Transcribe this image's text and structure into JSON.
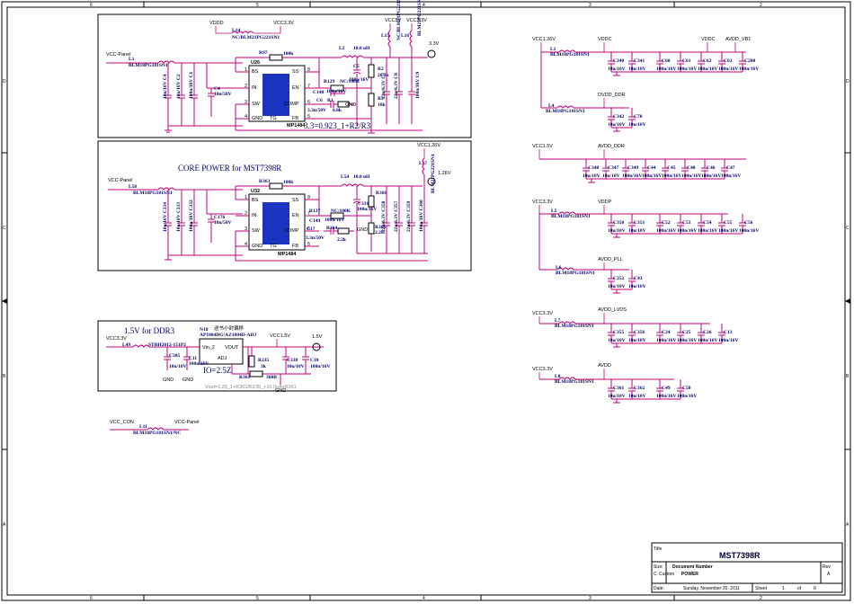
{
  "frame": {
    "cols": [
      "6",
      "5",
      "4",
      "3",
      "2",
      "1"
    ],
    "rows": [
      "D",
      "C",
      "B",
      "A"
    ]
  },
  "sections": {
    "core_power_title": "CORE POWER for MST7398R",
    "ddr_title": "1.5V  for  DDR3",
    "formula": "3.3=0.923_1+R2/R3",
    "vout_formula": "Vout=1.25_1+R361/R235_+10.0uAxR361"
  },
  "nets": {
    "vddd": "VDDD",
    "vcc33": "VCC3.3V",
    "vcc5v": "VCC5V",
    "vcc_panel": "VCC-Panel",
    "vcc126": "VCC1.26V",
    "vcc15": "VCC1.5V",
    "v15": "1.5V",
    "v126": "1.26V",
    "v33": "3.3V",
    "vddc": "VDDC",
    "avdd_vb1": "AVDD_VB1",
    "dvdd_ddr": "DVDD_DDR",
    "avdd_ddr": "AVDD_DDR",
    "vddp": "VDDP",
    "avdd_pll": "AVDD_PLL",
    "avdd_lvds": "AVDD_LVDS",
    "avdd": "AVDD",
    "vcc_con": "VCC_CON",
    "gnd": "GND"
  },
  "parts": {
    "l14": "L14",
    "l14_val": "NC/BLM21PG221SN1",
    "l1": "L1",
    "l1_val": "BLM18PG181SN1",
    "u26": "U26",
    "u26_part": "MP1484",
    "l2": "L2",
    "l2_val": "10.0 uH",
    "r97": "R97",
    "r97_val": "100k",
    "c5": "C5",
    "c5_val": "100u/16V",
    "r2": "R2",
    "r2_val": "26.1k",
    "r3": "R3",
    "r3_val": "10k",
    "r129": "R129",
    "r129_val": "NC/100K",
    "c148": "C148",
    "c148_val": "100n/16V",
    "c6": "C6",
    "r1": "R1",
    "r1_val": "6.8k",
    "c6_val": "3.3n/50V",
    "c4": "C4",
    "c4_val": "10n/50V",
    "l15": "L15",
    "l16": "L16",
    "u32": "U32",
    "u32_part": "MP1484",
    "l58": "L58",
    "l58_val": "BLM18PG181SN1",
    "l54": "L54",
    "l54_val": "10.0 uH",
    "r363": "R363",
    "r363_val": "100k",
    "c176": "C176",
    "c176_val": "10n/50V",
    "r137": "R137",
    "r137_val": "NC/100K",
    "c149": "C149",
    "c149_val": "100n/16V",
    "c17": "C17",
    "c17_val": "3.3n/50V",
    "r364": "R364",
    "r364_val": "2.2k",
    "r366": "R366",
    "c331": "C331",
    "c331_val": "100u/16V",
    "r365": "R365",
    "r365_val": "2.2K",
    "l17": "L17",
    "n18": "N18",
    "n18_part": "AP1084DG/AZ1084D-ADJ",
    "n18_note": "送书小封偏移",
    "l49": "L49",
    "l49_val": "STBH2012-151P2",
    "c385": "C385",
    "c385_val": "10u/10V",
    "c11": "C11",
    "c11_val": "100n/16V",
    "r235": "R235",
    "r235_val": "3k",
    "c338": "C338",
    "c338_val": "10u/10V",
    "c10": "C10",
    "c10_val": "100n/16V",
    "r361": "R361",
    "r361_val": "360R",
    "io": "IO=2.5Z",
    "l11": "L11",
    "l11_val": "BLM18PG181SN1/NC",
    "l4": "L4",
    "l5": "L5",
    "l6": "L6",
    "l7": "L7",
    "l8": "L8",
    "blm": "BLM18PG181SN1",
    "cap_10u": "10u/10V",
    "cap_100n": "100n/16V",
    "cap_22u": "22u/6.3V",
    "cap_10u16": "10u/16V"
  },
  "pins": {
    "bs": "BS",
    "in": "IN",
    "sw": "SW",
    "gnd": "GND",
    "ss": "SS",
    "en": "EN",
    "comp": "COMP",
    "fb": "FB",
    "tg": "TG",
    "vin2": "Vin_2",
    "vout": "VOUT",
    "adj": "ADJ"
  },
  "right_caps": {
    "row1": [
      "C340",
      "C341",
      "C60",
      "C61",
      "C62",
      "C63",
      "C200"
    ],
    "row2": [
      "C342",
      "C70"
    ],
    "row3": [
      "C348",
      "C347",
      "C349",
      "C44",
      "C45",
      "C40",
      "C46",
      "C47"
    ],
    "row4": [
      "C350",
      "C351",
      "C52",
      "C53",
      "C54",
      "C55",
      "C56"
    ],
    "row5": [
      "C352",
      "C43"
    ],
    "row6": [
      "C355",
      "C356",
      "C24",
      "C25",
      "C26",
      "C13"
    ],
    "row7": [
      "C361",
      "C362",
      "C49",
      "C50"
    ]
  },
  "title_block": {
    "title_lbl": "Title",
    "title": "MST7398R",
    "size_lbl": "Size",
    "size": "C",
    "docnum_lbl": "Document Number",
    "custom": "Custom",
    "docnum": "POWER",
    "rev_lbl": "Rev",
    "rev": "A",
    "date_lbl": "Date:",
    "date": "Sunday, November 20, 2011",
    "sheet_lbl": "Sheet",
    "sheet": "1",
    "of_lbl": "of",
    "sheets": "6"
  }
}
